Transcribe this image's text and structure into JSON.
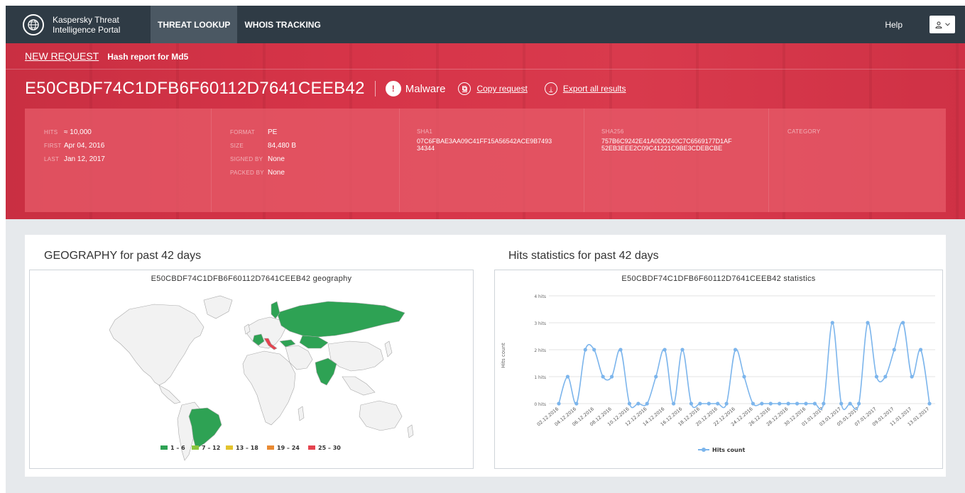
{
  "nav": {
    "logo_text": "Kaspersky Threat Intelligence Portal",
    "tabs": [
      {
        "label": "THREAT LOOKUP",
        "active": true
      },
      {
        "label": "WHOIS TRACKING",
        "active": false
      }
    ],
    "help": "Help",
    "user_icon": "user-icon"
  },
  "header": {
    "new_request": "NEW REQUEST",
    "subtitle": "Hash report for Md5",
    "hash": "E50CBDF74C1DFB6F60112D7641CEEB42",
    "verdict": "Malware",
    "copy_request": "Copy request",
    "export_results": "Export all results"
  },
  "summary": {
    "hits_label": "HITS",
    "hits": "≈ 10,000",
    "first_label": "FIRST",
    "first": "Apr 04, 2016",
    "last_label": "LAST",
    "last": "Jan 12, 2017",
    "format_label": "FORMAT",
    "format": "PE",
    "size_label": "SIZE",
    "size": "84,480 B",
    "signed_label": "SIGNED BY",
    "signed": "None",
    "packed_label": "PACKED BY",
    "packed": "None",
    "sha1_label": "SHA1",
    "sha1_line1": "07C6FBAE3AA09C41FF15A56542ACE9B7493",
    "sha1_line2": "34344",
    "sha256_label": "SHA256",
    "sha256_line1": "757B6C9242E41A0DD240C7C6569177D1AF",
    "sha256_line2": "52EB3EEE2C09C41221C9BE3CDEBCBE",
    "category_label": "CATEGORY"
  },
  "geography": {
    "section_title": "GEOGRAPHY for past 42 days",
    "chart_title": "E50CBDF74C1DFB6F60112D7641CEEB42 geography",
    "legend": [
      {
        "label": "1 – 6",
        "color": "#2ea254"
      },
      {
        "label": "7 – 12",
        "color": "#8cc63f"
      },
      {
        "label": "13 – 18",
        "color": "#e3c32d"
      },
      {
        "label": "19 – 24",
        "color": "#e98a32"
      },
      {
        "label": "25 – 30",
        "color": "#e5434f"
      }
    ]
  },
  "stats": {
    "section_title": "Hits statistics for past 42 days",
    "chart_title": "E50CBDF74C1DFB6F60112D7641CEEB42 statistics",
    "ylabel": "Hits count",
    "legend": "Hits count"
  },
  "chart_data": {
    "type": "line",
    "title": "E50CBDF74C1DFB6F60112D7641CEEB42 statistics",
    "ylabel": "Hits count",
    "ylim": [
      0,
      4
    ],
    "yticks": [
      "0 hits",
      "1 hits",
      "2 hits",
      "3 hits",
      "4 hits"
    ],
    "x": [
      "02.12.2016",
      "03.12.2016",
      "04.12.2016",
      "05.12.2016",
      "06.12.2016",
      "07.12.2016",
      "08.12.2016",
      "09.12.2016",
      "10.12.2016",
      "11.12.2016",
      "12.12.2016",
      "13.12.2016",
      "14.12.2016",
      "15.12.2016",
      "16.12.2016",
      "17.12.2016",
      "18.12.2016",
      "19.12.2016",
      "20.12.2016",
      "21.12.2016",
      "22.12.2016",
      "23.12.2016",
      "24.12.2016",
      "25.12.2016",
      "26.12.2016",
      "27.12.2016",
      "28.12.2016",
      "29.12.2016",
      "30.12.2016",
      "31.12.2016",
      "01.01.2017",
      "02.01.2017",
      "03.01.2017",
      "04.01.2017",
      "05.01.2017",
      "06.01.2017",
      "07.01.2017",
      "08.01.2017",
      "09.01.2017",
      "10.01.2017",
      "11.01.2017",
      "12.01.2017",
      "13.01.2017"
    ],
    "xtick_labels": [
      "02.12.2016",
      "04.12.2016",
      "06.12.2016",
      "08.12.2016",
      "10.12.2016",
      "12.12.2016",
      "14.12.2016",
      "16.12.2016",
      "18.12.2016",
      "20.12.2016",
      "22.12.2016",
      "24.12.2016",
      "26.12.2016",
      "28.12.2016",
      "30.12.2016",
      "01.01.2017",
      "03.01.2017",
      "05.01.2017",
      "07.01.2017",
      "09.01.2017",
      "11.01.2017",
      "13.01.2017"
    ],
    "series": [
      {
        "name": "Hits count",
        "color": "#7cb5ec",
        "values": [
          0,
          1,
          0,
          2,
          2,
          1,
          1,
          2,
          0,
          0,
          0,
          1,
          2,
          0,
          2,
          0,
          0,
          0,
          0,
          0,
          2,
          1,
          0,
          0,
          0,
          0,
          0,
          0,
          0,
          0,
          0,
          3,
          0,
          0,
          0,
          3,
          1,
          1,
          2,
          3,
          1,
          2,
          0
        ]
      }
    ],
    "grid": true,
    "legend_position": "bottom"
  }
}
